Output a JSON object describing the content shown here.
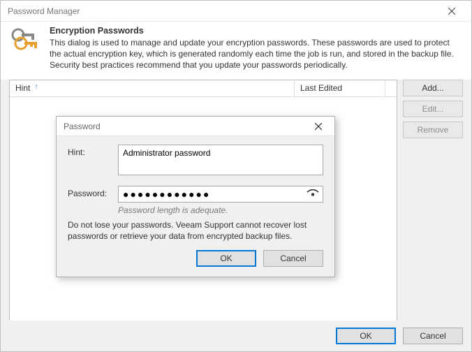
{
  "window": {
    "title": "Password Manager"
  },
  "header": {
    "title": "Encryption Passwords",
    "description": "This dialog is used to manage and update your encryption passwords. These passwords are used to protect the actual encryption key, which is generated randomly each time the job is run, and stored in the backup file. Security best practices recommend that you update your passwords periodically."
  },
  "list": {
    "columns": {
      "hint": "Hint",
      "last_edited": "Last Edited"
    },
    "sort_indicator": "↑"
  },
  "side_buttons": {
    "add": "Add...",
    "edit": "Edit...",
    "remove": "Remove"
  },
  "main_buttons": {
    "ok": "OK",
    "cancel": "Cancel"
  },
  "inner_dialog": {
    "title": "Password",
    "labels": {
      "hint": "Hint:",
      "password": "Password:"
    },
    "values": {
      "hint": "Administrator password",
      "password_mask": "●●●●●●●●●●●●"
    },
    "strength": "Password length is adequate.",
    "warning": "Do not lose your passwords. Veeam Support cannot recover lost passwords or retrieve your data from encrypted backup files.",
    "buttons": {
      "ok": "OK",
      "cancel": "Cancel"
    }
  }
}
